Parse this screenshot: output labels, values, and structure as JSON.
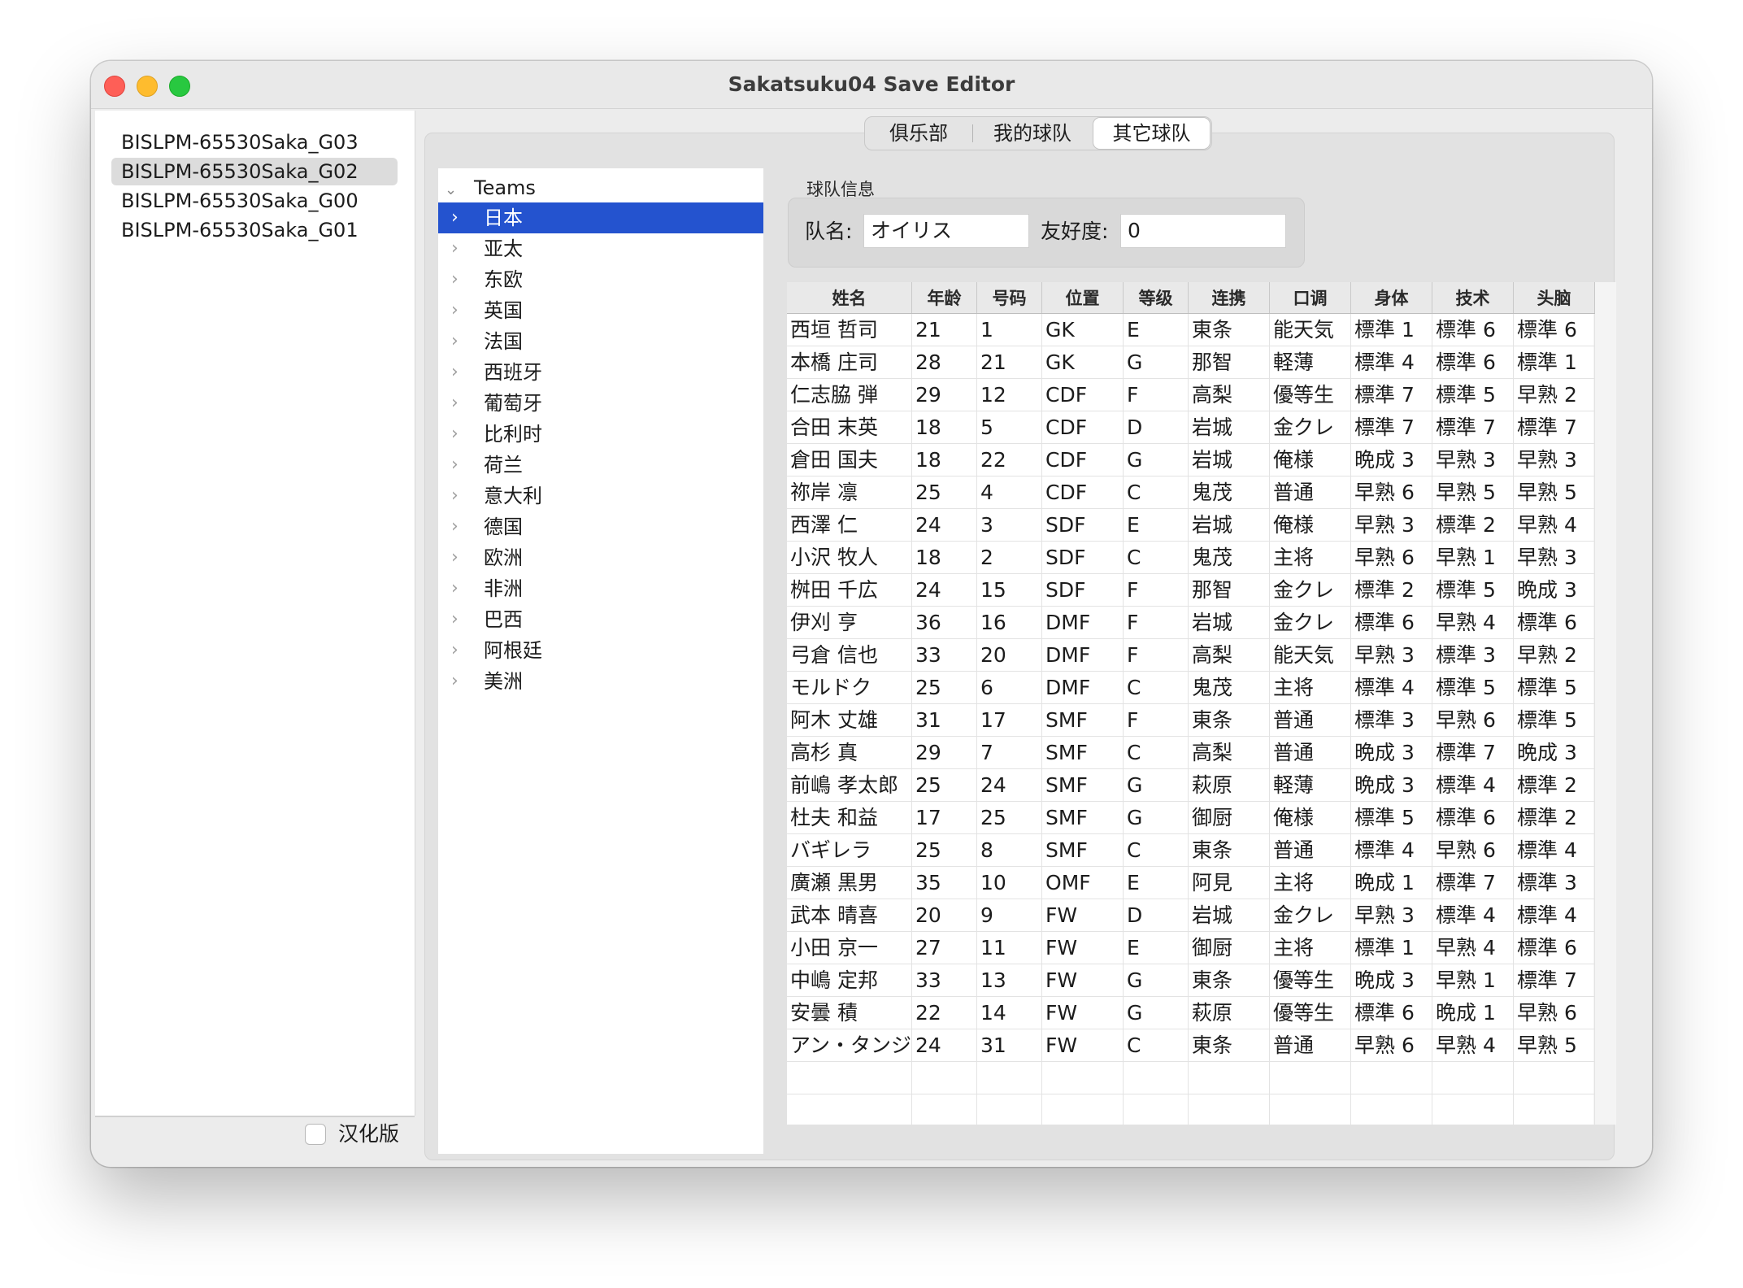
{
  "window": {
    "title": "Sakatsuku04 Save Editor"
  },
  "files": [
    {
      "label": "BISLPM-65530Saka_G03",
      "selected": false
    },
    {
      "label": "BISLPM-65530Saka_G02",
      "selected": true
    },
    {
      "label": "BISLPM-65530Saka_G00",
      "selected": false
    },
    {
      "label": "BISLPM-65530Saka_G01",
      "selected": false
    }
  ],
  "localized_checkbox": {
    "label": "汉化版",
    "checked": false
  },
  "tabs": [
    {
      "label": "俱乐部",
      "active": false
    },
    {
      "label": "我的球队",
      "active": false
    },
    {
      "label": "其它球队",
      "active": true
    }
  ],
  "tree": {
    "root": "Teams",
    "items": [
      "日本",
      "亚太",
      "东欧",
      "英国",
      "法国",
      "西班牙",
      "葡萄牙",
      "比利时",
      "荷兰",
      "意大利",
      "德国",
      "欧洲",
      "非洲",
      "巴西",
      "阿根廷",
      "美洲"
    ],
    "selected": "日本"
  },
  "team_info": {
    "group_title": "球队信息",
    "name_label": "队名:",
    "name_value": "オイリス",
    "friendship_label": "友好度:",
    "friendship_value": "0"
  },
  "table": {
    "columns": [
      "姓名",
      "年龄",
      "号码",
      "位置",
      "等级",
      "连携",
      "口调",
      "身体",
      "技术",
      "头脑"
    ],
    "rows": [
      [
        "西垣 哲司",
        "21",
        "1",
        "GK",
        "E",
        "東条",
        "能天気",
        "標準 1",
        "標準 6",
        "標準 6"
      ],
      [
        "本橋 庄司",
        "28",
        "21",
        "GK",
        "G",
        "那智",
        "軽薄",
        "標準 4",
        "標準 6",
        "標準 1"
      ],
      [
        "仁志脇 弾",
        "29",
        "12",
        "CDF",
        "F",
        "高梨",
        "優等生",
        "標準 7",
        "標準 5",
        "早熟 2"
      ],
      [
        "合田 末英",
        "18",
        "5",
        "CDF",
        "D",
        "岩城",
        "金クレ",
        "標準 7",
        "標準 7",
        "標準 7"
      ],
      [
        "倉田 国夫",
        "18",
        "22",
        "CDF",
        "G",
        "岩城",
        "俺様",
        "晩成 3",
        "早熟 3",
        "早熟 3"
      ],
      [
        "祢岸 凛",
        "25",
        "4",
        "CDF",
        "C",
        "鬼茂",
        "普通",
        "早熟 6",
        "早熟 5",
        "早熟 5"
      ],
      [
        "西澤 仁",
        "24",
        "3",
        "SDF",
        "E",
        "岩城",
        "俺様",
        "早熟 3",
        "標準 2",
        "早熟 4"
      ],
      [
        "小沢 牧人",
        "18",
        "2",
        "SDF",
        "C",
        "鬼茂",
        "主将",
        "早熟 6",
        "早熟 1",
        "早熟 3"
      ],
      [
        "桝田 千広",
        "24",
        "15",
        "SDF",
        "F",
        "那智",
        "金クレ",
        "標準 2",
        "標準 5",
        "晩成 3"
      ],
      [
        "伊刈 亨",
        "36",
        "16",
        "DMF",
        "F",
        "岩城",
        "金クレ",
        "標準 6",
        "早熟 4",
        "標準 6"
      ],
      [
        "弓倉 信也",
        "33",
        "20",
        "DMF",
        "F",
        "高梨",
        "能天気",
        "早熟 3",
        "標準 3",
        "早熟 2"
      ],
      [
        "モルドク",
        "25",
        "6",
        "DMF",
        "C",
        "鬼茂",
        "主将",
        "標準 4",
        "標準 5",
        "標準 5"
      ],
      [
        "阿木 丈雄",
        "31",
        "17",
        "SMF",
        "F",
        "東条",
        "普通",
        "標準 3",
        "早熟 6",
        "標準 5"
      ],
      [
        "高杉 真",
        "29",
        "7",
        "SMF",
        "C",
        "高梨",
        "普通",
        "晩成 3",
        "標準 7",
        "晩成 3"
      ],
      [
        "前嶋 孝太郎",
        "25",
        "24",
        "SMF",
        "G",
        "萩原",
        "軽薄",
        "晩成 3",
        "標準 4",
        "標準 2"
      ],
      [
        "杜夫 和益",
        "17",
        "25",
        "SMF",
        "G",
        "御厨",
        "俺様",
        "標準 5",
        "標準 6",
        "標準 2"
      ],
      [
        "バギレラ",
        "25",
        "8",
        "SMF",
        "C",
        "東条",
        "普通",
        "標準 4",
        "早熟 6",
        "標準 4"
      ],
      [
        "廣瀬 黒男",
        "35",
        "10",
        "OMF",
        "E",
        "阿見",
        "主将",
        "晩成 1",
        "標準 7",
        "標準 3"
      ],
      [
        "武本 晴喜",
        "20",
        "9",
        "FW",
        "D",
        "岩城",
        "金クレ",
        "早熟 3",
        "標準 4",
        "標準 4"
      ],
      [
        "小田 京一",
        "27",
        "11",
        "FW",
        "E",
        "御厨",
        "主将",
        "標準 1",
        "早熟 4",
        "標準 6"
      ],
      [
        "中嶋 定邦",
        "33",
        "13",
        "FW",
        "G",
        "東条",
        "優等生",
        "晩成 3",
        "早熟 1",
        "標準 7"
      ],
      [
        "安曇 積",
        "22",
        "14",
        "FW",
        "G",
        "萩原",
        "優等生",
        "標準 6",
        "晩成 1",
        "早熟 6"
      ],
      [
        "アン・タンジ",
        "24",
        "31",
        "FW",
        "C",
        "東条",
        "普通",
        "早熟 6",
        "早熟 4",
        "早熟 5"
      ]
    ]
  }
}
